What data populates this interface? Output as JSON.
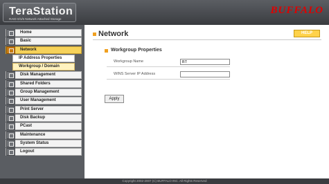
{
  "header": {
    "logo_title": "TeraStation",
    "logo_subtitle": "RAID 0/1/5 Network Attached Storage",
    "brand": "BUFFALO"
  },
  "sidebar": {
    "items": [
      {
        "label": "Home",
        "icon": "home-icon"
      },
      {
        "label": "Basic",
        "icon": "basic-icon"
      },
      {
        "label": "Network",
        "icon": "network-icon",
        "active": true
      },
      {
        "label": "IP Address Properties",
        "sub": true
      },
      {
        "label": "Workgroup / Domain",
        "sub": true,
        "selected": true
      },
      {
        "label": "Disk Management",
        "icon": "disk-icon"
      },
      {
        "label": "Shared Folders",
        "icon": "folder-icon"
      },
      {
        "label": "Group Management",
        "icon": "group-icon"
      },
      {
        "label": "User Management",
        "icon": "user-icon"
      },
      {
        "label": "Print Server",
        "icon": "printer-icon"
      },
      {
        "label": "Disk Backup",
        "icon": "backup-icon"
      },
      {
        "label": "PCast",
        "icon": "pcast-icon"
      },
      {
        "label": "Maintenance",
        "icon": "maintenance-icon"
      },
      {
        "label": "System Status",
        "icon": "status-icon"
      },
      {
        "label": "Logout",
        "icon": "logout-icon"
      }
    ]
  },
  "main": {
    "title": "Network",
    "help_label": "HELP",
    "section_title": "Workgroup Properties",
    "fields": [
      {
        "label": "Workgroup Name",
        "value": "BT"
      },
      {
        "label": "WINS Server IP Address",
        "value": ""
      }
    ],
    "apply_label": "Apply"
  },
  "footer": {
    "copyright": "Copyright 2002-2007 (C) BUFFALO INC. All Rights Reserved"
  },
  "colors": {
    "header_bg": "#4a4c50",
    "brand_red": "#e00000",
    "active_nav": "#f6d25a",
    "accent_orange": "#f0a020"
  }
}
